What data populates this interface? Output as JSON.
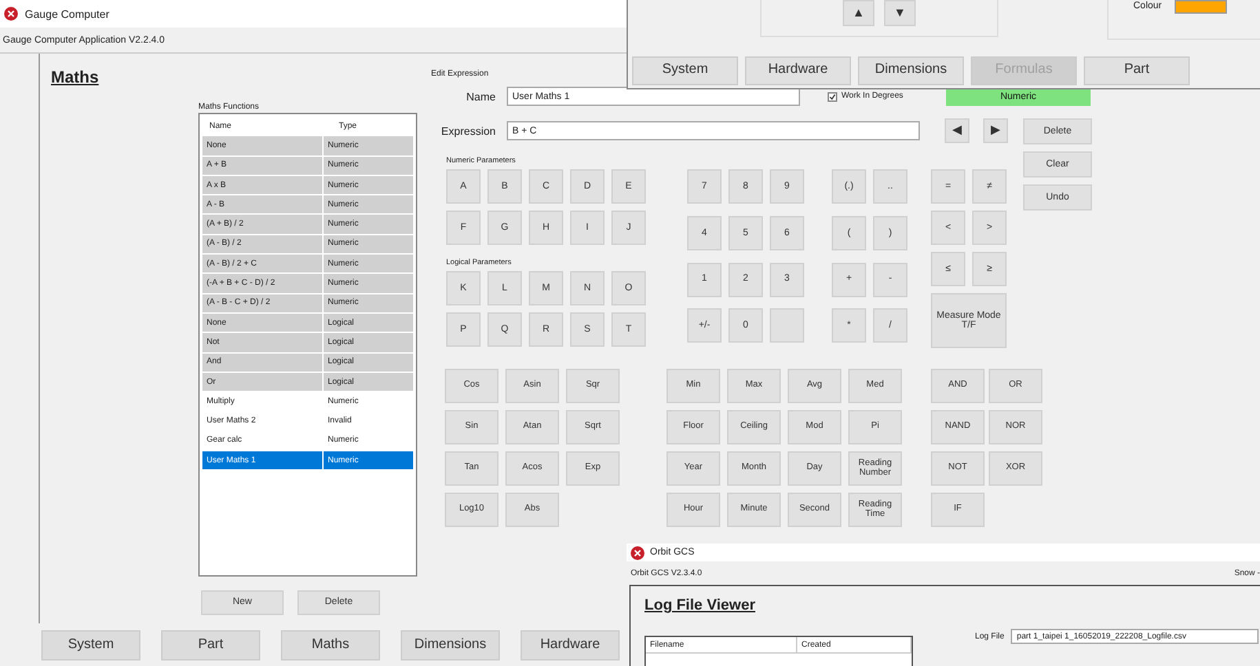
{
  "window": {
    "title": "Gauge Computer",
    "subtitle": "Gauge Computer Application V2.2.4.0"
  },
  "page_title": "Maths",
  "functions_list": {
    "label": "Maths Functions",
    "columns": [
      "Name",
      "Type"
    ],
    "rows": [
      {
        "name": "None",
        "type": "Numeric",
        "builtin": true,
        "selected": false
      },
      {
        "name": "A + B",
        "type": "Numeric",
        "builtin": true,
        "selected": false
      },
      {
        "name": "A x B",
        "type": "Numeric",
        "builtin": true,
        "selected": false
      },
      {
        "name": "A - B",
        "type": "Numeric",
        "builtin": true,
        "selected": false
      },
      {
        "name": "(A + B) / 2",
        "type": "Numeric",
        "builtin": true,
        "selected": false
      },
      {
        "name": "(A - B) / 2",
        "type": "Numeric",
        "builtin": true,
        "selected": false
      },
      {
        "name": "(A - B) / 2 + C",
        "type": "Numeric",
        "builtin": true,
        "selected": false
      },
      {
        "name": "(-A + B + C - D) / 2",
        "type": "Numeric",
        "builtin": true,
        "selected": false
      },
      {
        "name": "(A - B - C + D) / 2",
        "type": "Numeric",
        "builtin": true,
        "selected": false
      },
      {
        "name": "None",
        "type": "Logical",
        "builtin": true,
        "selected": false
      },
      {
        "name": "Not",
        "type": "Logical",
        "builtin": true,
        "selected": false
      },
      {
        "name": "And",
        "type": "Logical",
        "builtin": true,
        "selected": false
      },
      {
        "name": "Or",
        "type": "Logical",
        "builtin": true,
        "selected": false
      },
      {
        "name": "Multiply",
        "type": "Numeric",
        "builtin": false,
        "selected": false
      },
      {
        "name": "User Maths 2",
        "type": "Invalid",
        "builtin": false,
        "selected": false
      },
      {
        "name": "Gear calc",
        "type": "Numeric",
        "builtin": false,
        "selected": false
      },
      {
        "name": "User Maths 1",
        "type": "Numeric",
        "builtin": false,
        "selected": true
      }
    ]
  },
  "list_buttons": [
    "New",
    "Delete"
  ],
  "editor": {
    "label": "Edit Expression",
    "name_label": "Name",
    "name_value": "User Maths 1",
    "degrees": {
      "label": "Work In Degrees",
      "checked": true
    },
    "status": "Numeric",
    "expression_label": "Expression",
    "expression_value": "B + C",
    "nav": [
      "◀",
      "▶"
    ],
    "actions": [
      "Delete",
      "Clear",
      "Undo"
    ],
    "numeric_label": "Numeric Parameters",
    "numeric_keys": [
      "A",
      "B",
      "C",
      "D",
      "E",
      "F",
      "G",
      "H",
      "I",
      "J"
    ],
    "logical_label": "Logical Parameters",
    "logical_keys": [
      "K",
      "L",
      "M",
      "N",
      "O",
      "P",
      "Q",
      "R",
      "S",
      "T"
    ],
    "digits": [
      "7",
      "8",
      "9",
      "4",
      "5",
      "6",
      "1",
      "2",
      "3",
      "+/-",
      "0"
    ],
    "operators": [
      "(.)",
      "..",
      "(",
      ")",
      "+",
      "-",
      "*",
      "/"
    ],
    "comparisons": [
      "=",
      "≠",
      "<",
      ">",
      "≤",
      "≥"
    ],
    "measure_mode": "Measure Mode T/F",
    "trig": [
      "Cos",
      "Asin",
      "Sqr",
      "Sin",
      "Atan",
      "Sqrt",
      "Tan",
      "Acos",
      "Exp",
      "Log10",
      "Abs"
    ],
    "stats": [
      "Min",
      "Max",
      "Avg",
      "Med",
      "Floor",
      "Ceiling",
      "Mod",
      "Pi",
      "Year",
      "Month",
      "Day",
      "Reading Number",
      "Hour",
      "Minute",
      "Second",
      "Reading Time"
    ],
    "logic": [
      "AND",
      "OR",
      "NAND",
      "NOR",
      "NOT",
      "XOR",
      "IF"
    ]
  },
  "tabs": [
    {
      "label": "System",
      "selected": false
    },
    {
      "label": "Part",
      "selected": false
    },
    {
      "label": "Maths",
      "selected": false
    },
    {
      "label": "Dimensions",
      "selected": false
    },
    {
      "label": "Hardware",
      "selected": false
    }
  ],
  "top_window": {
    "arrows": [
      "▲",
      "▼"
    ],
    "colour_label": "Colour",
    "color": "#ffa500",
    "tabs": [
      {
        "label": "System",
        "disabled": false
      },
      {
        "label": "Hardware",
        "disabled": false
      },
      {
        "label": "Dimensions",
        "disabled": false
      },
      {
        "label": "Formulas",
        "disabled": true
      },
      {
        "label": "Part",
        "disabled": false
      }
    ]
  },
  "log_window": {
    "title": "Orbit GCS",
    "subtitle": "Orbit GCS V2.3.4.0",
    "user": "Snow -",
    "heading": "Log File Viewer",
    "columns": [
      "Filename",
      "Created"
    ],
    "log_file_label": "Log File",
    "log_file_value": "part 1_taipei 1_16052019_222208_Logfile.csv"
  }
}
